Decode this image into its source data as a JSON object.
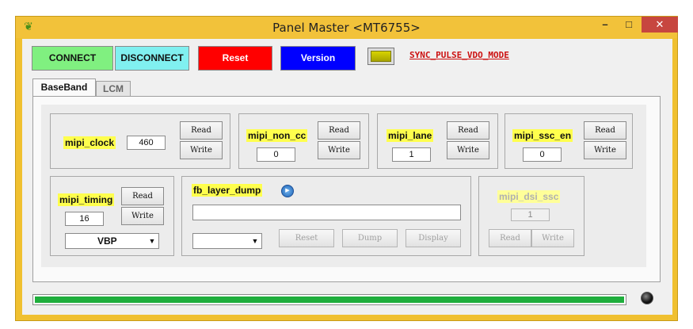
{
  "window": {
    "title": "Panel Master <MT6755>",
    "controls": {
      "minimize": "–",
      "maximize": "□",
      "close": "✕"
    }
  },
  "toolbar": {
    "connect": "CONNECT",
    "disconnect": "DISCONNECT",
    "reset": "Reset",
    "version": "Version",
    "mode_link": "SYNC_PULSE_VDO_MODE",
    "colors": {
      "connect": "#80f080",
      "disconnect": "#80f0f0",
      "reset": "#ff0000",
      "version": "#0000ff"
    }
  },
  "tabs": [
    {
      "label": "BaseBand",
      "active": true
    },
    {
      "label": "LCM",
      "active": false
    }
  ],
  "groups": {
    "mipi_clock": {
      "label": "mipi_clock",
      "value": "460",
      "read": "Read",
      "write": "Write"
    },
    "mipi_non_cc": {
      "label": "mipi_non_cc",
      "value": "0",
      "read": "Read",
      "write": "Write"
    },
    "mipi_lane": {
      "label": "mipi_lane",
      "value": "1",
      "read": "Read",
      "write": "Write"
    },
    "mipi_ssc_en": {
      "label": "mipi_ssc_en",
      "value": "0",
      "read": "Read",
      "write": "Write"
    },
    "mipi_timing": {
      "label": "mipi_timing",
      "value": "16",
      "read": "Read",
      "write": "Write",
      "select": "VBP"
    },
    "fb_layer_dump": {
      "label": "fb_layer_dump",
      "path_value": "",
      "select": "",
      "reset": "Reset",
      "dump": "Dump",
      "display": "Display"
    },
    "mipi_dsi_ssc": {
      "label": "mipi_dsi_ssc",
      "value": "1",
      "read": "Read",
      "write": "Write"
    }
  },
  "progress": {
    "value_percent": 100
  },
  "icons": {
    "app": "leaf-icon",
    "play": "play-icon",
    "status": "status-led-icon",
    "dropdown": "chevron-down-icon"
  }
}
